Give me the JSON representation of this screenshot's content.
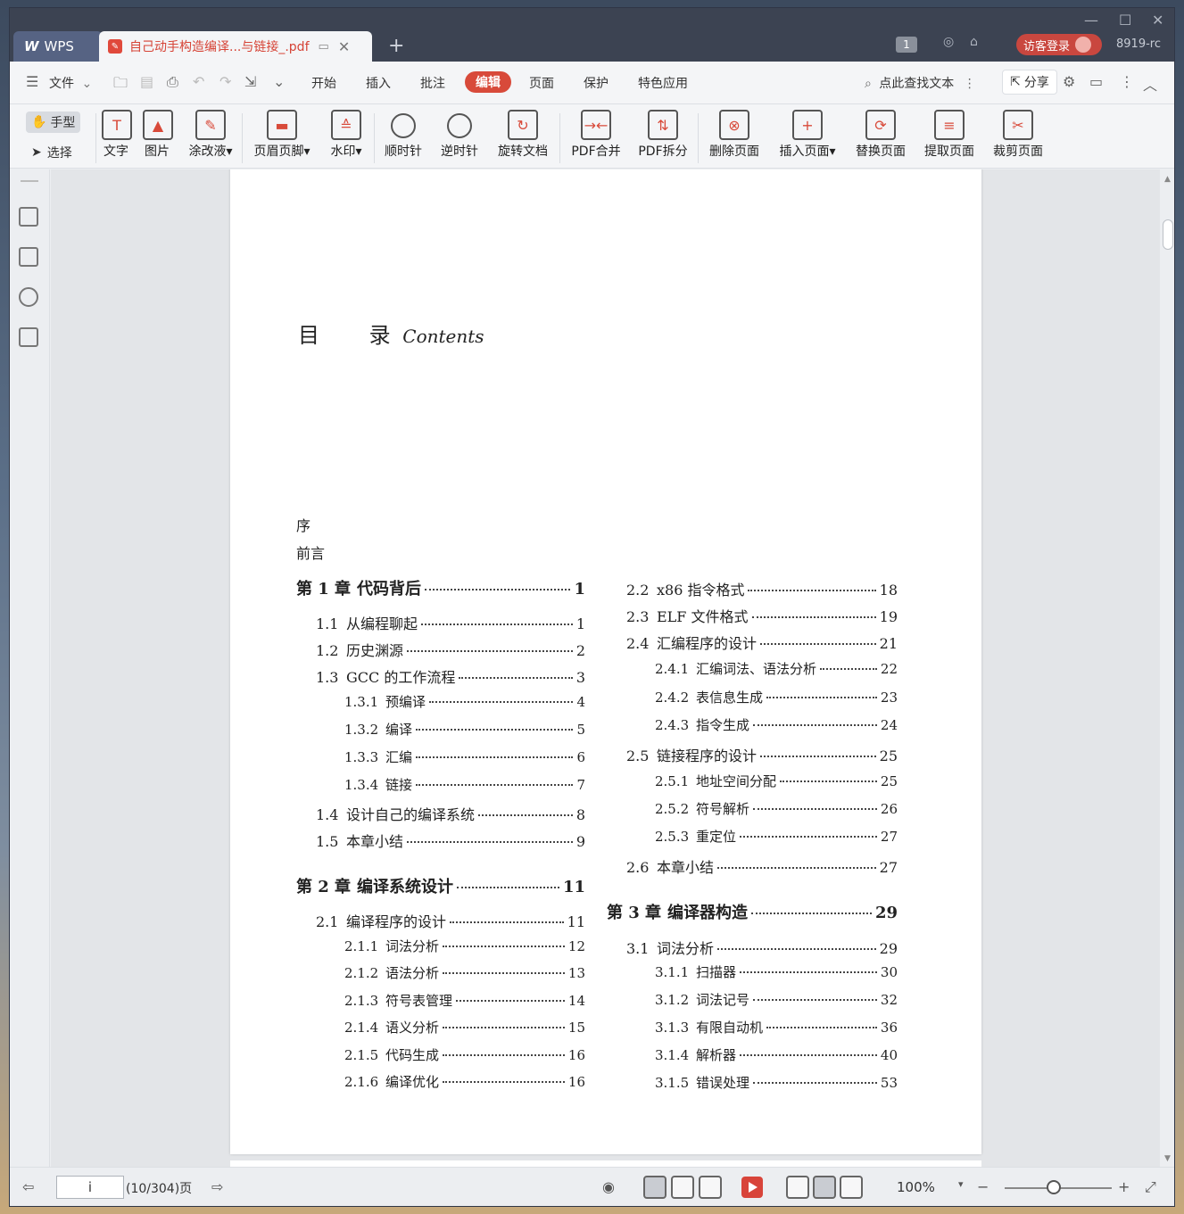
{
  "titlebar": {
    "app_tab": "WPS",
    "app_logo": "W",
    "doc_tab": "自己动手构造编译...与链接_.pdf",
    "badge": "1",
    "login": "访客登录",
    "user_id": "8919-rc"
  },
  "menu": {
    "file": "文件",
    "items": [
      "开始",
      "插入",
      "批注",
      "编辑",
      "页面",
      "保护",
      "特色应用"
    ],
    "active": "编辑",
    "search": "点此查找文本",
    "share": "分享"
  },
  "ribbon": {
    "hand": "手型",
    "select": "选择",
    "tools": [
      "文字",
      "图片",
      "涂改液",
      "页眉页脚",
      "水印",
      "顺时针",
      "逆时针",
      "旋转文档",
      "PDF合并",
      "PDF拆分",
      "删除页面",
      "插入页面",
      "替换页面",
      "提取页面",
      "裁剪页面"
    ]
  },
  "document": {
    "toc_title": "目",
    "toc_title2": "录",
    "toc_contents": "Contents",
    "pre1": "序",
    "pre2": "前言",
    "left": [
      {
        "num": "第 1 章",
        "title": "代码背后",
        "page": "1",
        "level": 0
      },
      {
        "num": "1.1",
        "title": "从编程聊起",
        "page": "1",
        "level": 1
      },
      {
        "num": "1.2",
        "title": "历史渊源",
        "page": "2",
        "level": 1
      },
      {
        "num": "1.3",
        "title": "GCC 的工作流程",
        "page": "3",
        "level": 1
      },
      {
        "num": "1.3.1",
        "title": "预编译",
        "page": "4",
        "level": 2
      },
      {
        "num": "1.3.2",
        "title": "编译",
        "page": "5",
        "level": 2
      },
      {
        "num": "1.3.3",
        "title": "汇编",
        "page": "6",
        "level": 2
      },
      {
        "num": "1.3.4",
        "title": "链接",
        "page": "7",
        "level": 2
      },
      {
        "num": "1.4",
        "title": "设计自己的编译系统",
        "page": "8",
        "level": 1
      },
      {
        "num": "1.5",
        "title": "本章小结",
        "page": "9",
        "level": 1
      },
      {
        "num": "第 2 章",
        "title": "编译系统设计",
        "page": "11",
        "level": 0
      },
      {
        "num": "2.1",
        "title": "编译程序的设计",
        "page": "11",
        "level": 1
      },
      {
        "num": "2.1.1",
        "title": "词法分析",
        "page": "12",
        "level": 2
      },
      {
        "num": "2.1.2",
        "title": "语法分析",
        "page": "13",
        "level": 2
      },
      {
        "num": "2.1.3",
        "title": "符号表管理",
        "page": "14",
        "level": 2
      },
      {
        "num": "2.1.4",
        "title": "语义分析",
        "page": "15",
        "level": 2
      },
      {
        "num": "2.1.5",
        "title": "代码生成",
        "page": "16",
        "level": 2
      },
      {
        "num": "2.1.6",
        "title": "编译优化",
        "page": "16",
        "level": 2
      }
    ],
    "right": [
      {
        "num": "2.2",
        "title": "x86 指令格式",
        "page": "18",
        "level": 1
      },
      {
        "num": "2.3",
        "title": "ELF 文件格式",
        "page": "19",
        "level": 1
      },
      {
        "num": "2.4",
        "title": "汇编程序的设计",
        "page": "21",
        "level": 1
      },
      {
        "num": "2.4.1",
        "title": "汇编词法、语法分析",
        "page": "22",
        "level": 2
      },
      {
        "num": "2.4.2",
        "title": "表信息生成",
        "page": "23",
        "level": 2
      },
      {
        "num": "2.4.3",
        "title": "指令生成",
        "page": "24",
        "level": 2
      },
      {
        "num": "2.5",
        "title": "链接程序的设计",
        "page": "25",
        "level": 1
      },
      {
        "num": "2.5.1",
        "title": "地址空间分配",
        "page": "25",
        "level": 2
      },
      {
        "num": "2.5.2",
        "title": "符号解析",
        "page": "26",
        "level": 2
      },
      {
        "num": "2.5.3",
        "title": "重定位",
        "page": "27",
        "level": 2
      },
      {
        "num": "2.6",
        "title": "本章小结",
        "page": "27",
        "level": 1
      },
      {
        "num": "第 3 章",
        "title": "编译器构造",
        "page": "29",
        "level": 0
      },
      {
        "num": "3.1",
        "title": "词法分析",
        "page": "29",
        "level": 1
      },
      {
        "num": "3.1.1",
        "title": "扫描器",
        "page": "30",
        "level": 2
      },
      {
        "num": "3.1.2",
        "title": "词法记号",
        "page": "32",
        "level": 2
      },
      {
        "num": "3.1.3",
        "title": "有限自动机",
        "page": "36",
        "level": 2
      },
      {
        "num": "3.1.4",
        "title": "解析器",
        "page": "40",
        "level": 2
      },
      {
        "num": "3.1.5",
        "title": "错误处理",
        "page": "53",
        "level": 2
      }
    ]
  },
  "status": {
    "page_input": "i",
    "page_count": "(10/304)页",
    "zoom": "100%"
  },
  "colors": {
    "accent": "#d84a3a",
    "titlebar": "#3c4352"
  }
}
